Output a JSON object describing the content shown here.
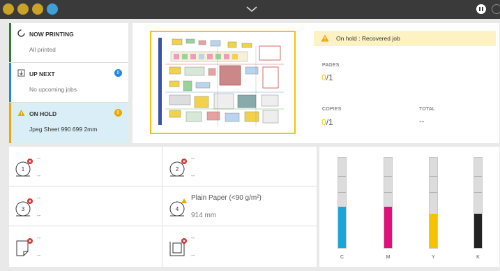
{
  "colors": {
    "topbar": "#3a3a3a",
    "accent_yellow": "#f5c300",
    "printing_green": "#2e7d32",
    "upnext_blue": "#1e88e5",
    "hold_orange": "#f0a500",
    "error_red": "#d32f2f"
  },
  "jobs": [
    {
      "title": "NOW PRINTING",
      "subtitle": "All printed",
      "icon": "spinner-icon"
    },
    {
      "title": "UP NEXT",
      "subtitle": "No upcoming jobs",
      "icon": "queue-icon",
      "badge": "0"
    },
    {
      "title": "ON HOLD",
      "subtitle": "Jpeg Sheet 990 699 2mm",
      "icon": "warning-icon",
      "badge": "0"
    }
  ],
  "alert": {
    "text": "On hold : Recovered job"
  },
  "info": {
    "pages_label": "PAGES",
    "pages_done": "0",
    "pages_total": "/1",
    "copies_label": "COPIES",
    "copies_done": "0",
    "copies_total": "/1",
    "total_label": "TOTAL",
    "total_value": "--"
  },
  "trays": [
    {
      "number": "1",
      "line1": "--",
      "line2": "--",
      "status": "error"
    },
    {
      "number": "2",
      "line1": "--",
      "line2": "--",
      "status": "error"
    },
    {
      "number": "3",
      "line1": "--",
      "line2": "--",
      "status": "error"
    },
    {
      "number": "4",
      "line1": "Plain Paper (<90 g/m²)",
      "line2": "914 mm",
      "status": "warning"
    },
    {
      "number": "",
      "line1": "--",
      "line2": "--",
      "status": "error",
      "icon": "sheet-icon"
    },
    {
      "number": "",
      "line1": "--",
      "line2": "--",
      "status": "error",
      "icon": "stacker-icon"
    }
  ],
  "inks": [
    {
      "label": "C",
      "color": "#1aa7d8",
      "level": 0.46
    },
    {
      "label": "M",
      "color": "#e0107a",
      "level": 0.46
    },
    {
      "label": "Y",
      "color": "#f5c300",
      "level": 0.38
    },
    {
      "label": "K",
      "color": "#222222",
      "level": 0.38
    }
  ]
}
